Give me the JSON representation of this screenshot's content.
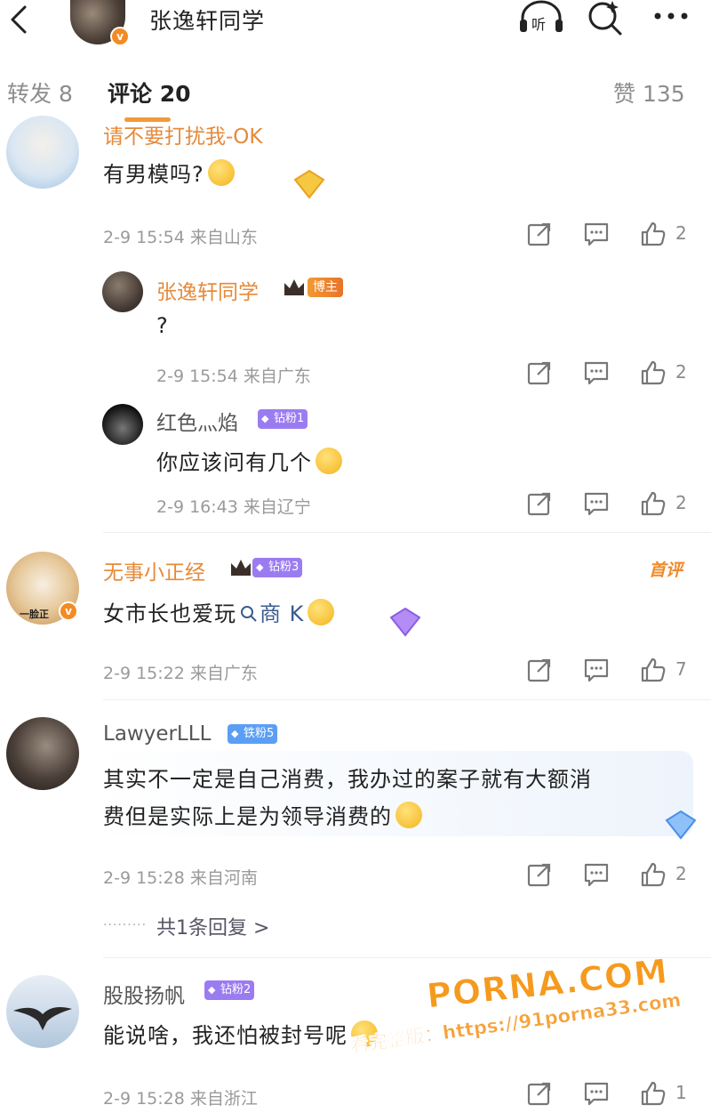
{
  "header": {
    "title": "张逸轩同学",
    "verified_mark": "v",
    "icons": [
      "back-arrow-icon",
      "listen-icon",
      "search-icon",
      "more-icon"
    ],
    "listen_label": "听"
  },
  "tabs": {
    "repost": "转发 8",
    "comments": "评论 20",
    "likes": "赞 135",
    "active_color": "#f29a3a"
  },
  "comments": [
    {
      "user": "请不要打扰我-OK",
      "text": "有男模吗?",
      "meta": "2-9 15:54  来自山东",
      "likes": "2"
    },
    {
      "user": "张逸轩同学",
      "badge": "博主",
      "text": "?",
      "meta": "2-9 15:54  来自广东",
      "likes": "2"
    },
    {
      "user": "红色灬焰",
      "badge": "钻粉1",
      "text": "你应该问有几个",
      "meta": "2-9 16:43  来自辽宁",
      "likes": "2"
    },
    {
      "user": "无事小正经",
      "badge": "钻粉3",
      "tag": "首评",
      "text_before": "女市长也爱玩",
      "search_term": "商 K",
      "meta": "2-9 15:22  来自广东",
      "likes": "7",
      "avatar_caption": "一脸正"
    },
    {
      "user": "LawyerLLL",
      "badge": "铁粉5",
      "text_line1": "其实不一定是自己消费，我办过的案子就有大额消",
      "text_line2": "费但是实际上是为领导消费的",
      "meta": "2-9 15:28  来自河南",
      "likes": "2",
      "replies": "共1条回复 >"
    },
    {
      "user": "股股扬帆",
      "badge": "钻粉2",
      "text": "能说啥，我还怕被封号呢",
      "meta": "2-9 15:28  来自浙江",
      "likes": "1"
    }
  ],
  "watermark": {
    "site": "PORNA.COM",
    "line": "看完整版：https://91porna33.com"
  },
  "colors": {
    "accent_orange": "#e68a3a",
    "badge_purple": "#9b7cf0",
    "badge_blue": "#5b9ef5",
    "meta_gray": "#9a9a9a"
  }
}
